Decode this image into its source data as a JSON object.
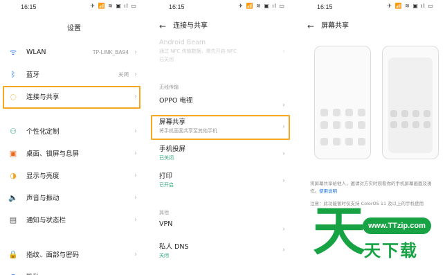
{
  "status": {
    "time": "16:15",
    "icons": "✈ 📶 ≋ ▣ ıl ▭"
  },
  "left": {
    "title": "设置",
    "items": [
      {
        "icon": "wifi-icon",
        "glyph": "ᯤ",
        "color": "#1a73e8",
        "label": "WLAN",
        "value": "TP-LINK_BA94"
      },
      {
        "icon": "bluetooth-icon",
        "glyph": "ᛒ",
        "color": "#1a73e8",
        "label": "蓝牙",
        "value": "关闭"
      },
      {
        "icon": "connection-icon",
        "glyph": "◌",
        "color": "#f5a623",
        "label": "连接与共享",
        "value": ""
      },
      {
        "icon": "personalize-icon",
        "glyph": "⚇",
        "color": "#2aa876",
        "label": "个性化定制",
        "value": ""
      },
      {
        "icon": "desktop-icon",
        "glyph": "▣",
        "color": "#e86a1a",
        "label": "桌面、锁屏与息屏",
        "value": ""
      },
      {
        "icon": "display-icon",
        "glyph": "◑",
        "color": "#f5a623",
        "label": "显示与亮度",
        "value": ""
      },
      {
        "icon": "sound-icon",
        "glyph": "🔈",
        "color": "#2aa876",
        "label": "声音与振动",
        "value": ""
      },
      {
        "icon": "notification-icon",
        "glyph": "▤",
        "color": "#555555",
        "label": "通知与状态栏",
        "value": ""
      },
      {
        "icon": "fingerprint-icon",
        "glyph": "🔒",
        "color": "#1a73e8",
        "label": "指纹、面部与密码",
        "value": ""
      },
      {
        "icon": "privacy-icon",
        "glyph": "◍",
        "color": "#1a73e8",
        "label": "隐私",
        "value": ""
      }
    ]
  },
  "middle": {
    "title": "连接与共享",
    "android_beam": {
      "label": "Android Beam",
      "sub": "通过 NFC 传输数据，需先开启 NFC",
      "sub2": "已关闭"
    },
    "section_wireless": "无线传输",
    "items": [
      {
        "label": "OPPO 电视",
        "sub": "",
        "green": false
      },
      {
        "label": "屏幕共享",
        "sub": "将手机画面共享至其他手机",
        "green": false
      },
      {
        "label": "手机投屏",
        "sub": "已关闭",
        "green": true
      },
      {
        "label": "打印",
        "sub": "已开启",
        "green": true
      }
    ],
    "section_other": "其他",
    "other_items": [
      {
        "label": "VPN",
        "sub": "",
        "green": false
      },
      {
        "label": "私人 DNS",
        "sub": "关闭",
        "green": true
      }
    ]
  },
  "right": {
    "title": "屏幕共享",
    "desc1": "将屏幕共享给他人，邀请对方实时观看你的手机屏幕画面及操作。",
    "desc1_link": "使用说明",
    "desc2": "注意：此功能暂时仅支持 ColorOS 11 及以上的手机使用"
  },
  "watermark": {
    "big": "天",
    "url": "www.TTzip.com",
    "small": "天下载"
  },
  "colors": {
    "highlight": "#f5a623",
    "accent_green": "#2aa876",
    "link": "#1a73e8",
    "watermark": "#17a344"
  }
}
